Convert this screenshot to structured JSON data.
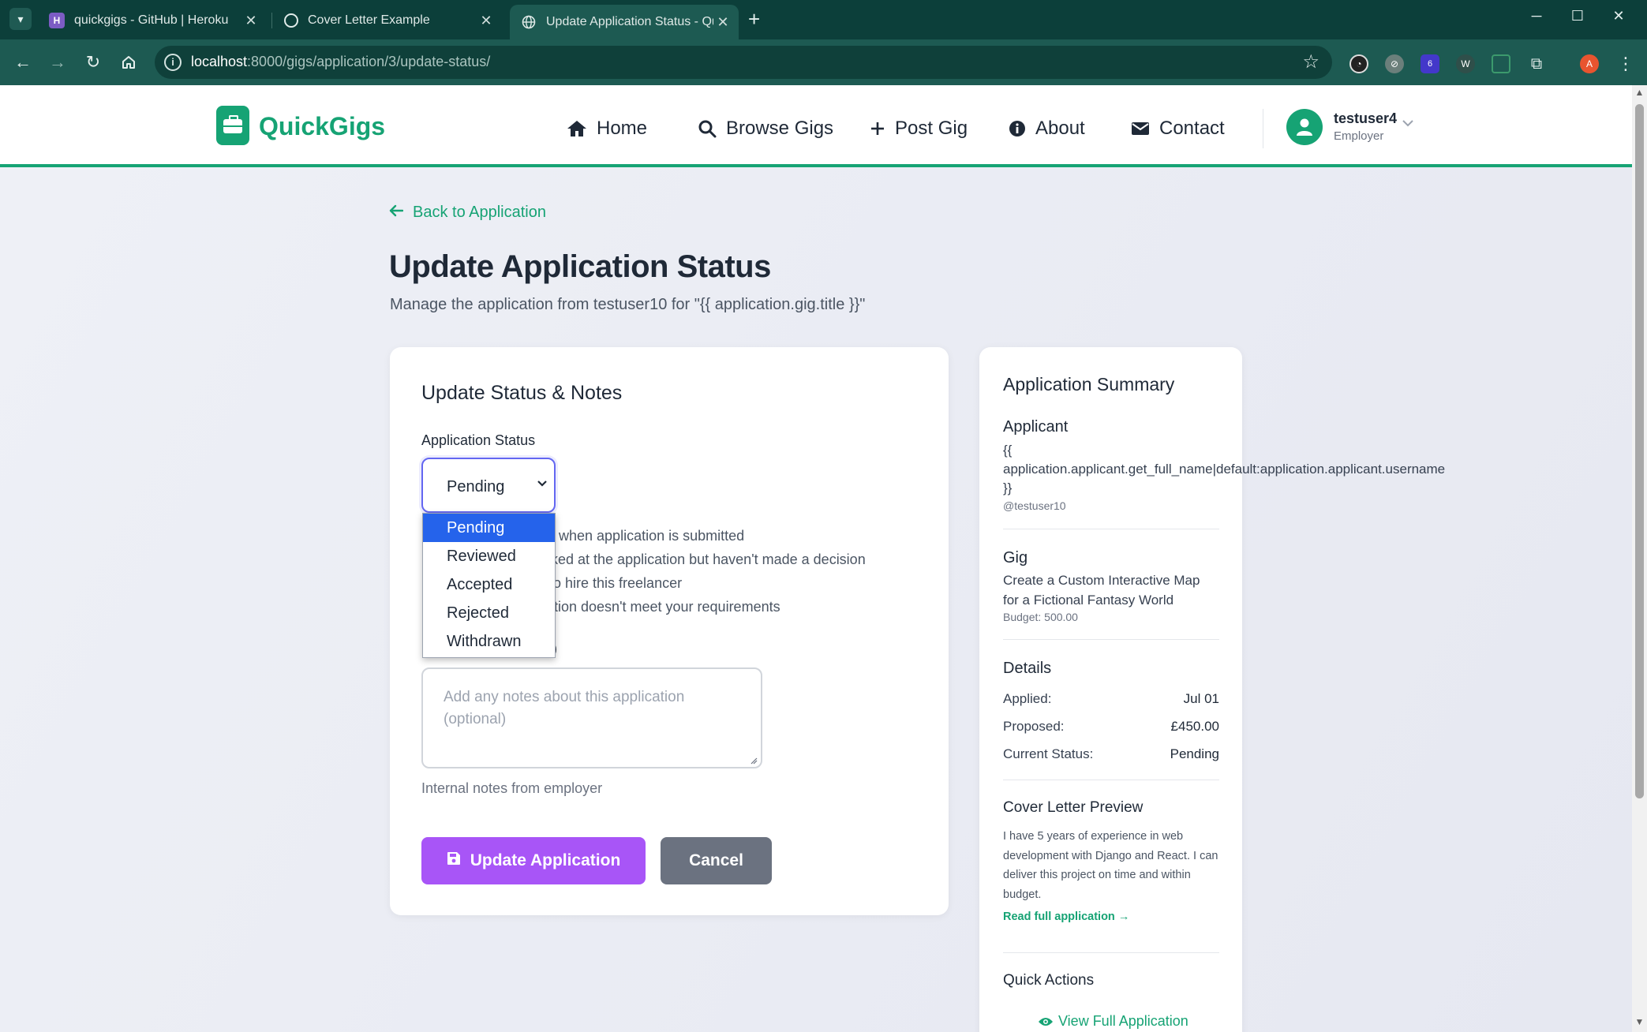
{
  "browser": {
    "tabs": [
      {
        "title": "quickgigs - GitHub | Heroku",
        "favicon": "H"
      },
      {
        "title": "Cover Letter Example",
        "favicon": "gpt"
      },
      {
        "title": "Update Application Status - QuickGigs",
        "favicon": "globe"
      }
    ],
    "url_host": "localhost",
    "url_rest": ":8000/gigs/application/3/update-status/",
    "profile_initial": "A",
    "extension_badge": "6"
  },
  "site": {
    "brand": "QuickGigs",
    "brand_color": "#16a374",
    "nav": [
      {
        "label": "Home",
        "icon": "home-icon"
      },
      {
        "label": "Browse Gigs",
        "icon": "search-icon"
      },
      {
        "label": "Post Gig",
        "icon": "plus-icon"
      },
      {
        "label": "About",
        "icon": "info-icon"
      },
      {
        "label": "Contact",
        "icon": "envelope-icon"
      }
    ],
    "user": {
      "name": "testuser4",
      "role": "Employer"
    }
  },
  "page": {
    "back_label": "Back to Application",
    "title": "Update Application Status",
    "subtitle": "Manage the application from testuser10 for \"{{ application.gig.title }}\""
  },
  "form": {
    "heading": "Update Status & Notes",
    "status_label": "Application Status",
    "status_value": "Pending",
    "status_options": [
      "Pending",
      "Reviewed",
      "Accepted",
      "Rejected",
      "Withdrawn"
    ],
    "status_help": [
      "when application is submitted",
      "ked at the application but haven't made a decision",
      "o hire this freelancer",
      "tion doesn't meet your requirements"
    ],
    "notes_label_visible": ")",
    "notes_placeholder": "Add any notes about this application (optional)",
    "notes_help": "Internal notes from employer",
    "submit_label": "Update Application",
    "cancel_label": "Cancel",
    "submit_color": "#a855f7",
    "cancel_color": "#6b7280"
  },
  "summary": {
    "title": "Application Summary",
    "applicant_heading": "Applicant",
    "applicant_template_1": "{{",
    "applicant_template_2": "application.applicant.get_full_name|default:application.applicant.username",
    "applicant_template_3": "}}",
    "applicant_handle": "@testuser10",
    "gig_heading": "Gig",
    "gig_title": "Create a Custom Interactive Map for a Fictional Fantasy World",
    "gig_budget": "Budget: 500.00",
    "details_heading": "Details",
    "details": [
      {
        "label": "Applied:",
        "value": "Jul 01"
      },
      {
        "label": "Proposed:",
        "value": "£450.00"
      },
      {
        "label": "Current Status:",
        "value": "Pending"
      }
    ],
    "cover_heading": "Cover Letter Preview",
    "cover_text": "I have 5 years of experience in web development with Django and React. I can deliver this project on time and within budget.",
    "read_full": "Read full application →",
    "quick_actions_heading": "Quick Actions",
    "view_full": "View Full Application"
  }
}
